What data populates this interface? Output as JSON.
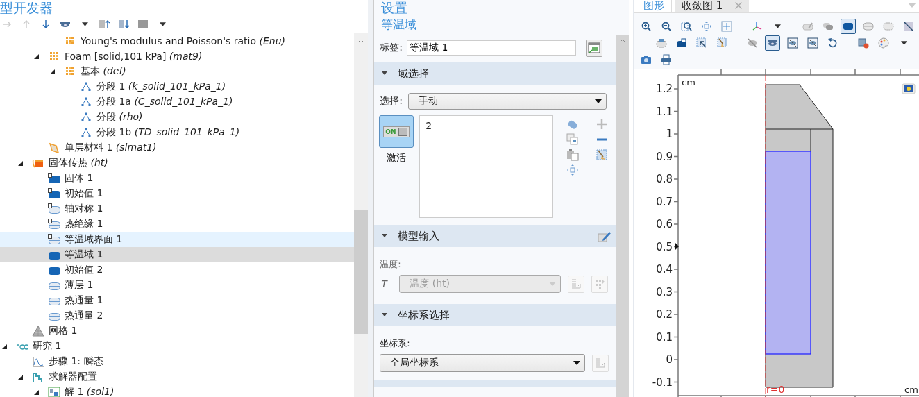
{
  "model_builder": {
    "title": "型开发器",
    "toolbar": [
      {
        "kind": "arrow-right",
        "disabled": true
      },
      {
        "kind": "arrow-up",
        "disabled": true
      },
      {
        "kind": "arrow-down",
        "disabled": false
      },
      {
        "kind": "eye",
        "disabled": false
      },
      {
        "kind": "caret",
        "disabled": false
      },
      {
        "kind": "list-up",
        "disabled": false
      },
      {
        "kind": "list-down",
        "disabled": false
      },
      {
        "kind": "list",
        "disabled": false
      },
      {
        "kind": "caret",
        "disabled": false
      }
    ],
    "tree": {
      "items": [
        {
          "children": [
            {
              "children": [
                {
                  "children": [
                    {
                      "label": "Young's modulus and Poisson's ratio  *(Enu)*",
                      "kind": "material",
                      "selected": false,
                      "hovered": false
                    }
                  ]
                },
                {
                  "label": "Foam [solid,101 kPa]  *(mat9)*",
                  "kind": "material",
                  "expanded": true,
                  "selected": false,
                  "hovered": false,
                  "children": [
                    {
                      "label": "基本  *(def)*",
                      "kind": "material",
                      "expanded": true,
                      "selected": false,
                      "hovered": false,
                      "children": [
                        {
                          "label": "分段 1  *(k_solid_101_kPa_1)*",
                          "kind": "function",
                          "selected": false,
                          "hovered": false
                        },
                        {
                          "label": "分段 1a  *(C_solid_101_kPa_1)*",
                          "kind": "function",
                          "selected": false,
                          "hovered": false
                        },
                        {
                          "label": "分段  *(rho)*",
                          "kind": "function",
                          "selected": false,
                          "hovered": false
                        },
                        {
                          "label": "分段 1b  *(TD_solid_101_kPa_1)*",
                          "kind": "function",
                          "selected": false,
                          "hovered": false
                        }
                      ]
                    }
                  ]
                },
                {
                  "label": "单层材料 1  *(slmat1)*",
                  "kind": "layer",
                  "selected": false,
                  "hovered": false
                }
              ]
            },
            {
              "label": "固体传热  *(ht)*",
              "kind": "physics",
              "expanded": true,
              "selected": false,
              "hovered": false,
              "children": [
                {
                  "label": "固体 1",
                  "kind": "domain",
                  "default": true,
                  "selected": false,
                  "hovered": false
                },
                {
                  "label": "初始值 1",
                  "kind": "domain",
                  "default": true,
                  "selected": false,
                  "hovered": false
                },
                {
                  "label": "轴对称 1",
                  "kind": "boundary",
                  "default": true,
                  "selected": false,
                  "hovered": false
                },
                {
                  "label": "热绝缘 1",
                  "kind": "boundary",
                  "default": true,
                  "selected": false,
                  "hovered": false
                },
                {
                  "label": "等温域界面 1",
                  "kind": "boundary",
                  "default": true,
                  "selected": false,
                  "hovered": true
                },
                {
                  "label": "等温域 1",
                  "kind": "domain",
                  "default": false,
                  "selected": true,
                  "hovered": false
                },
                {
                  "label": "初始值 2",
                  "kind": "domain",
                  "default": false,
                  "selected": false,
                  "hovered": false
                },
                {
                  "label": "薄层 1",
                  "kind": "boundary",
                  "default": false,
                  "selected": false,
                  "hovered": false
                },
                {
                  "label": "热通量 1",
                  "kind": "boundary",
                  "default": false,
                  "selected": false,
                  "hovered": false
                },
                {
                  "label": "热通量 2",
                  "kind": "boundary",
                  "default": false,
                  "selected": false,
                  "hovered": false
                }
              ]
            },
            {
              "label": "网格 1",
              "kind": "mesh",
              "selected": false,
              "hovered": false
            }
          ]
        },
        {
          "label": "研究 1",
          "kind": "study",
          "expanded": true,
          "selected": false,
          "hovered": false,
          "children": [
            {
              "label": "步骤 1: 瞬态",
              "kind": "step",
              "selected": false,
              "hovered": false
            },
            {
              "label": "求解器配置",
              "kind": "solver",
              "expanded": true,
              "selected": false,
              "hovered": false,
              "children": [
                {
                  "label": "解 1  *(sol1)*",
                  "kind": "solution",
                  "expanded": true,
                  "selected": false,
                  "hovered": false
                }
              ]
            }
          ]
        }
      ]
    }
  },
  "settings": {
    "title": "设置",
    "subtitle": "等温域",
    "label_field": {
      "label": "标签:",
      "value": "等温域 1"
    },
    "sections": [
      {
        "kind": "selection",
        "title": "域选择",
        "expanded": true,
        "selection_label": "选择:",
        "selection_value": "手动",
        "toggle": {
          "text": "ON",
          "caption": "激活",
          "on": true
        },
        "entities": [
          "2"
        ]
      },
      {
        "kind": "model_input",
        "title": "模型输入",
        "expanded": true,
        "field_label": "温度:",
        "symbol": "T",
        "value": "温度 (ht)",
        "disabled": true
      },
      {
        "kind": "coordinate",
        "title": "坐标系选择",
        "expanded": true,
        "field_label": "坐标系:",
        "value": "全局坐标系"
      },
      {
        "kind": "cut"
      }
    ]
  },
  "graphics": {
    "tabs": [
      {
        "label": "图形",
        "selected": true,
        "closable": false
      },
      {
        "label": "收敛图 1",
        "selected": false,
        "closable": true
      }
    ],
    "toolbar_rows": [
      {
        "groups": [
          [
            {
              "kind": "zoom-in",
              "pressed": false
            },
            {
              "kind": "zoom-out",
              "pressed": false
            },
            {
              "kind": "zoom-box",
              "pressed": false
            },
            {
              "kind": "move",
              "pressed": false
            },
            {
              "kind": "fit",
              "pressed": false
            }
          ],
          [
            {
              "kind": "axes",
              "pressed": false
            },
            {
              "kind": "caret",
              "pressed": false
            }
          ],
          [
            {
              "kind": "eraser",
              "pressed": false
            },
            {
              "kind": "layers",
              "pressed": false
            },
            {
              "kind": "pill-filled",
              "pressed": true
            },
            {
              "kind": "pill",
              "pressed": false
            },
            {
              "kind": "pill-dashed",
              "pressed": false
            },
            {
              "kind": "slash",
              "pressed": false
            }
          ]
        ]
      },
      {
        "groups": [
          [
            {
              "kind": "pill-light",
              "pressed": false
            },
            {
              "kind": "pill-dark",
              "pressed": false
            },
            {
              "kind": "select-box",
              "pressed": false
            },
            {
              "kind": "broom",
              "pressed": false
            }
          ],
          [
            {
              "kind": "hide",
              "pressed": false
            },
            {
              "kind": "eye",
              "pressed": true
            },
            {
              "kind": "eye-box",
              "pressed": false
            },
            {
              "kind": "eye-box",
              "pressed": false
            },
            {
              "kind": "undo",
              "pressed": false
            }
          ],
          [
            {
              "kind": "cube-cancel",
              "pressed": false
            },
            {
              "kind": "palette",
              "pressed": false
            },
            {
              "kind": "caret",
              "pressed": false
            }
          ]
        ]
      },
      {
        "groups": [
          [
            {
              "kind": "camera",
              "pressed": false
            },
            {
              "kind": "print",
              "pressed": false
            }
          ]
        ]
      }
    ],
    "plot": {
      "top_unit": "cm",
      "bottom_unit": "cm",
      "axis_label": "r=0",
      "y_ticks": [
        "1.2",
        "1.1",
        "1",
        "0.9",
        "0.8",
        "0.7",
        "0.6",
        "0.5",
        "0.4",
        "0.3",
        "0.2",
        "0.1",
        "0",
        "-0.1"
      ]
    }
  }
}
